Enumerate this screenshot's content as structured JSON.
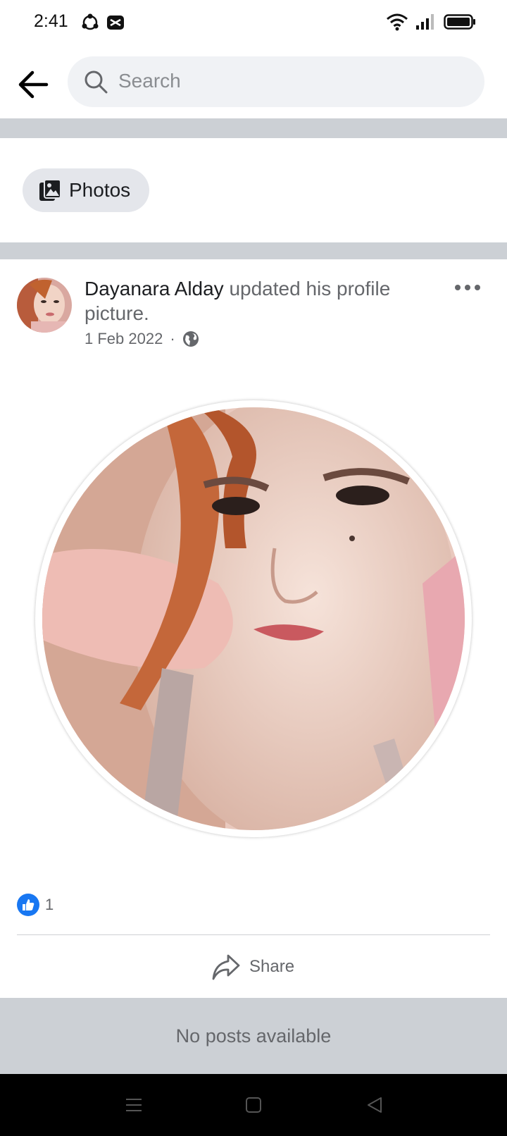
{
  "status_bar": {
    "time": "2:41"
  },
  "search": {
    "placeholder": "Search"
  },
  "filters": {
    "photos_label": "Photos"
  },
  "post": {
    "author": "Dayanara Alday",
    "action": "updated his profile picture.",
    "date": "1 Feb 2022",
    "separator": "·",
    "privacy_icon": "globe-icon",
    "reaction_count": "1",
    "share_label": "Share"
  },
  "feed": {
    "empty_message": "No posts available"
  },
  "colors": {
    "accent": "#1877f2",
    "band": "#ccd0d5",
    "search_bg": "#f0f2f5",
    "chip_bg": "#e4e6eb"
  }
}
